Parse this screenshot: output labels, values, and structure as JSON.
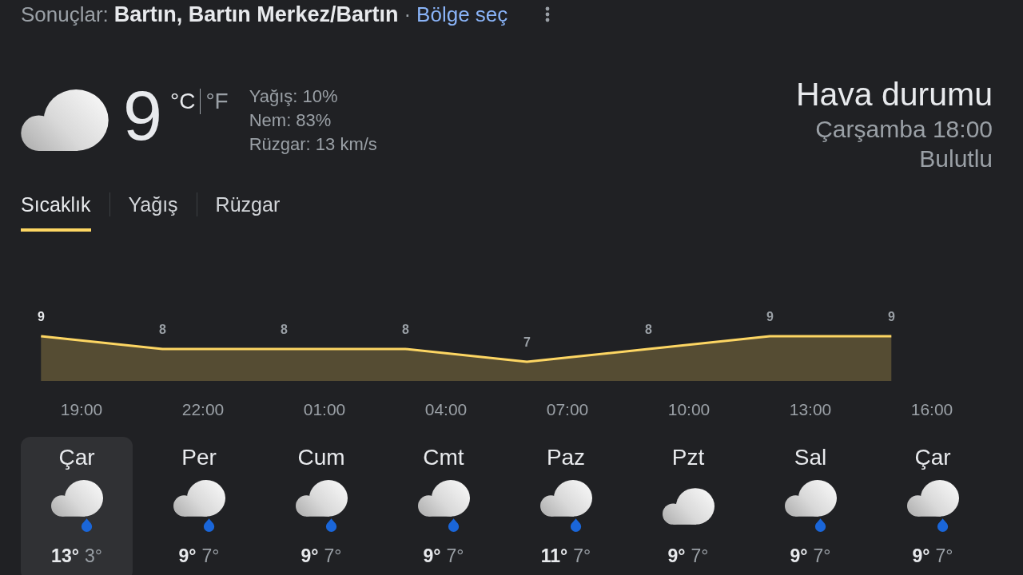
{
  "search_header": {
    "label": "Sonuçlar:",
    "location": "Bartın, Bartın Merkez/Bartın",
    "separator": "·",
    "region_link": "Bölge seç"
  },
  "current": {
    "temperature": "9",
    "units": [
      {
        "label": "°C",
        "selected": true
      },
      {
        "label": "°F",
        "selected": false
      }
    ],
    "details": [
      "Yağış: 10%",
      "Nem: 83%",
      "Rüzgar: 13 km/s"
    ]
  },
  "summary": {
    "title": "Hava durumu",
    "time": "Çarşamba 18:00",
    "condition": "Bulutlu"
  },
  "tabs": [
    {
      "label": "Sıcaklık",
      "selected": true
    },
    {
      "label": "Yağış",
      "selected": false
    },
    {
      "label": "Rüzgar",
      "selected": false
    }
  ],
  "hourly": {
    "chart_data": {
      "type": "area",
      "categories": [
        null,
        "19:00",
        null,
        null,
        "22:00",
        null,
        null,
        "01:00",
        null,
        null,
        "04:00",
        null,
        null,
        "07:00",
        null,
        null,
        "10:00",
        null,
        null,
        "13:00",
        null,
        null,
        "16:00",
        null
      ],
      "series": [
        {
          "color": "#fdd663",
          "values": [
            9,
            null,
            null,
            8,
            null,
            null,
            8,
            null,
            null,
            8,
            null,
            null,
            7,
            null,
            null,
            8,
            null,
            null,
            9,
            null,
            null,
            9,
            null,
            null
          ]
        }
      ],
      "data_labels": true
    },
    "labels_selected": [
      true,
      false,
      false,
      false,
      false,
      false,
      false,
      false
    ]
  },
  "days": [
    {
      "day": "Çar",
      "kind": "rain",
      "high": "13°",
      "low": "3°",
      "selected": true
    },
    {
      "day": "Per",
      "kind": "rain",
      "high": "9°",
      "low": "7°",
      "selected": false
    },
    {
      "day": "Cum",
      "kind": "rain",
      "high": "9°",
      "low": "7°",
      "selected": false
    },
    {
      "day": "Cmt",
      "kind": "rain",
      "high": "9°",
      "low": "7°",
      "selected": false
    },
    {
      "day": "Paz",
      "kind": "rain",
      "high": "11°",
      "low": "7°",
      "selected": false
    },
    {
      "day": "Pzt",
      "kind": "cloud",
      "high": "9°",
      "low": "7°",
      "selected": false
    },
    {
      "day": "Sal",
      "kind": "rain",
      "high": "9°",
      "low": "7°",
      "selected": false
    },
    {
      "day": "Çar",
      "kind": "rain",
      "high": "9°",
      "low": "7°",
      "selected": false
    }
  ]
}
